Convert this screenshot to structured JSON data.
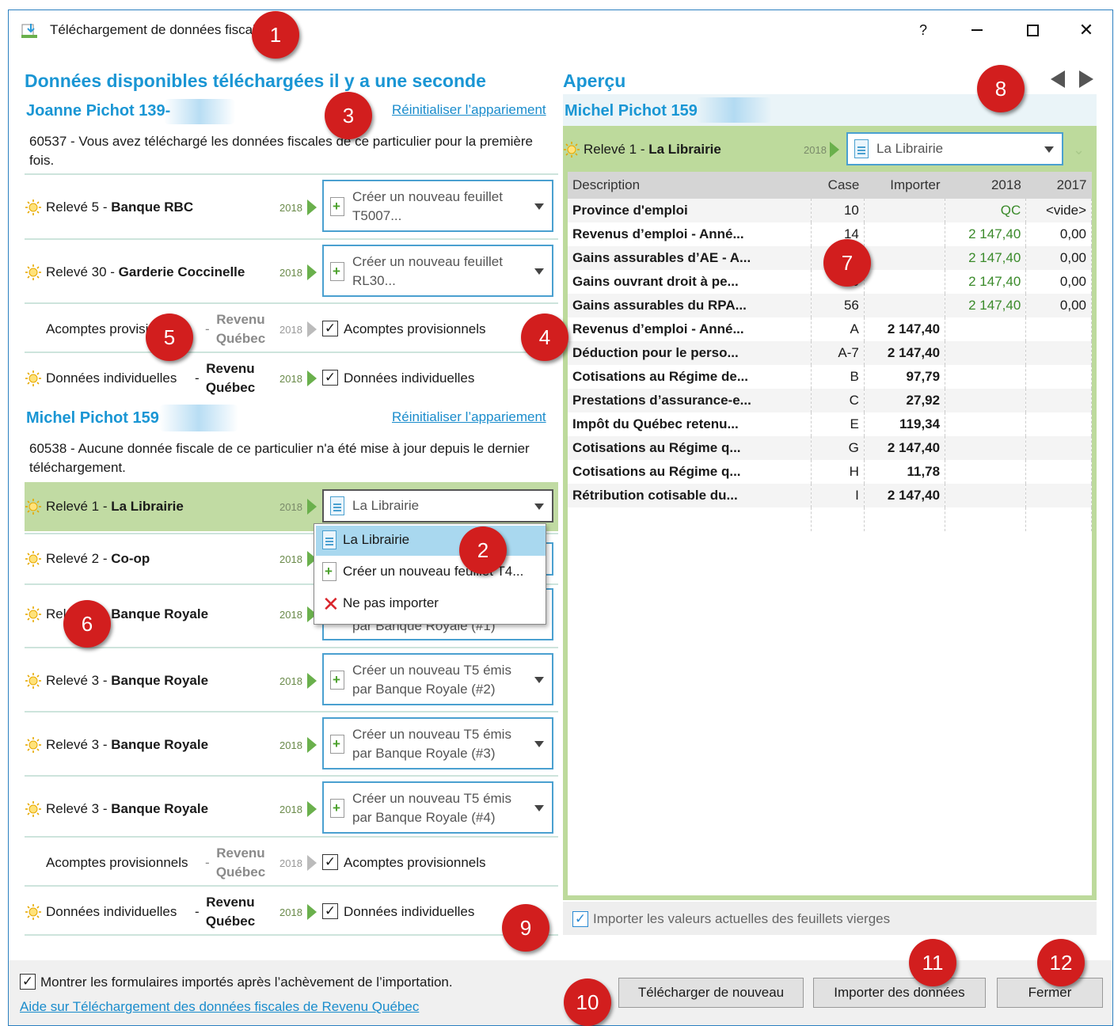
{
  "window": {
    "title": "Téléchargement de données fiscales",
    "help": "?",
    "minimize": "—",
    "maximize": "☐",
    "close": "✕"
  },
  "left": {
    "heading": "Données disponibles téléchargées il y a une seconde",
    "person1": {
      "name": "Joanne Pichot 139-",
      "reset_link": "Réinitialiser l’appariement",
      "message": "60537 - Vous avez téléchargé les données fiscales de ce particulier pour la première fois.",
      "rows": [
        {
          "slip": "Relevé 5",
          "sep": " - ",
          "issuer": "Banque RBC",
          "year": "2018",
          "combo": "Créer un nouveau feuillet T5007..."
        },
        {
          "slip": "Relevé 30",
          "sep": " - ",
          "issuer": "Garderie Coccinelle",
          "year": "2018",
          "combo": "Créer un nouveau feuillet RL30..."
        }
      ],
      "acomptes": {
        "label": "Acomptes provisionnels",
        "sep": "-",
        "agency": "Revenu Québec",
        "year": "2018",
        "check_label": "Acomptes provisionnels"
      },
      "individuelles": {
        "label": "Données individuelles",
        "sep": "-",
        "agency": "Revenu Québec",
        "year": "2018",
        "check_label": "Données individuelles"
      }
    },
    "person2": {
      "name": "Michel Pichot 159",
      "reset_link": "Réinitialiser l’appariement",
      "message": "60538 - Aucune donnée fiscale de ce particulier n'a été mise à jour depuis le dernier téléchargement.",
      "rows": [
        {
          "slip": "Relevé 1",
          "sep": " - ",
          "issuer": "La Librairie",
          "year": "2018",
          "combo": "La Librairie"
        },
        {
          "slip": "Relevé 2",
          "sep": " - ",
          "issuer": "Co-op",
          "year": "2018"
        },
        {
          "slip": "Relevé 3",
          "sep": " - ",
          "issuer": "Banque Royale",
          "year": "2018",
          "combo_hidden": "par Banque Royale (#1)"
        },
        {
          "slip": "Relevé 3",
          "sep": " - ",
          "issuer": "Banque Royale",
          "year": "2018",
          "combo": "Créer un nouveau T5 émis par Banque Royale (#2)"
        },
        {
          "slip": "Relevé 3",
          "sep": " - ",
          "issuer": "Banque Royale",
          "year": "2018",
          "combo": "Créer un nouveau T5 émis par Banque Royale (#3)"
        },
        {
          "slip": "Relevé 3",
          "sep": " - ",
          "issuer": "Banque Royale",
          "year": "2018",
          "combo": "Créer un nouveau T5 émis par Banque Royale (#4)"
        }
      ],
      "acomptes": {
        "label": "Acomptes provisionnels",
        "sep": "-",
        "agency": "Revenu Québec",
        "year": "2018",
        "check_label": "Acomptes provisionnels"
      },
      "individuelles": {
        "label": "Données individuelles",
        "sep": "-",
        "agency": "Revenu Québec",
        "year": "2018",
        "check_label": "Données individuelles"
      }
    },
    "dropdown": {
      "items": [
        "La Librairie",
        "Créer un nouveau feuillet T4...",
        "Ne pas importer"
      ]
    }
  },
  "preview": {
    "heading": "Aperçu",
    "person": "Michel Pichot 159",
    "slip": "Relevé 1",
    "sep": " - ",
    "issuer": "La Librairie",
    "year": "2018",
    "combo": "La Librairie",
    "columns": [
      "Description",
      "Case",
      "Importer",
      "2018",
      "2017"
    ],
    "rows": [
      {
        "desc": "Province d'emploi",
        "case": "10",
        "imp": "",
        "y2018": "QC",
        "y2017": "<vide>"
      },
      {
        "desc": "Revenus d’emploi - Anné...",
        "case": "14",
        "imp": "",
        "y2018": "2 147,40",
        "y2017": "0,00"
      },
      {
        "desc": "Gains assurables d’AE - A...",
        "case": "24",
        "imp": "",
        "y2018": "2 147,40",
        "y2017": "0,00"
      },
      {
        "desc": "Gains ouvrant droit à pe...",
        "case": "26",
        "imp": "",
        "y2018": "2 147,40",
        "y2017": "0,00"
      },
      {
        "desc": "Gains assurables du RPA...",
        "case": "56",
        "imp": "",
        "y2018": "2 147,40",
        "y2017": "0,00"
      },
      {
        "desc": "Revenus d’emploi - Anné...",
        "case": "A",
        "imp": "2 147,40",
        "y2018": "",
        "y2017": ""
      },
      {
        "desc": "Déduction pour le perso...",
        "case": "A-7",
        "imp": "2 147,40",
        "y2018": "",
        "y2017": ""
      },
      {
        "desc": "Cotisations au Régime de...",
        "case": "B",
        "imp": "97,79",
        "y2018": "",
        "y2017": ""
      },
      {
        "desc": "Prestations d’assurance-e...",
        "case": "C",
        "imp": "27,92",
        "y2018": "",
        "y2017": ""
      },
      {
        "desc": "Impôt du Québec retenu...",
        "case": "E",
        "imp": "119,34",
        "y2018": "",
        "y2017": ""
      },
      {
        "desc": "Cotisations au Régime q...",
        "case": "G",
        "imp": "2 147,40",
        "y2018": "",
        "y2017": ""
      },
      {
        "desc": "Cotisations au Régime q...",
        "case": "H",
        "imp": "11,78",
        "y2018": "",
        "y2017": ""
      },
      {
        "desc": "Rétribution cotisable du...",
        "case": "I",
        "imp": "2 147,40",
        "y2018": "",
        "y2017": ""
      }
    ],
    "import_blank_label": "Importer les valeurs actuelles des feuillets vierges"
  },
  "footer": {
    "show_forms_label": "Montrer les formulaires importés après l’achèvement de l’importation.",
    "help_link": "Aide sur Téléchargement des données fiscales de Revenu Québec",
    "btn_redownload": "Télécharger de nouveau",
    "btn_import": "Importer des données",
    "btn_close": "Fermer"
  },
  "badges": [
    "1",
    "2",
    "3",
    "4",
    "5",
    "6",
    "7",
    "8",
    "9",
    "10",
    "11",
    "12"
  ],
  "colors": {
    "accent": "#1a96d4",
    "selected_row": "#c1dba3",
    "badge": "#d21e1e",
    "green_value": "#3a8a2a"
  }
}
